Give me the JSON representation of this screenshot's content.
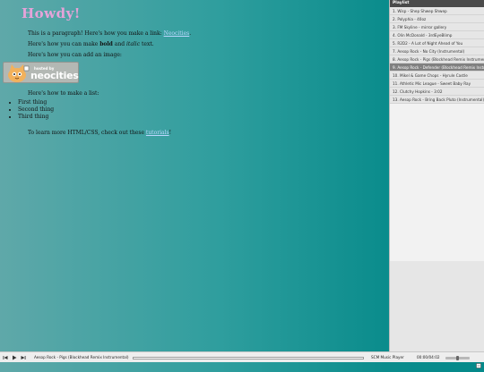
{
  "page": {
    "title": "Howdy!",
    "p1_before": "This is a paragraph! Here's how you make a link: ",
    "p1_link": "Neocities",
    "p1_after": ".",
    "p2_before": "Here's how you can make ",
    "p2_bold": "bold",
    "p2_mid": " and ",
    "p2_italic": "italic",
    "p2_after": " text.",
    "p3": "Here's how you can add an image:",
    "badge_hosted": "hosted by",
    "badge_brand": "neocities",
    "p4": "Here's how to make a list:",
    "list": [
      "First thing",
      "Second thing",
      "Third thing"
    ],
    "p5_before": "To learn more HTML/CSS, check out these ",
    "p5_link": "tutorials",
    "p5_after": "!"
  },
  "playlist": {
    "header": "Playlist",
    "active_index": 7,
    "items": [
      "1. Wisp - Shep Shwep Shwep",
      "2. Polyphia - 40oz",
      "3. FM Skyline - mirror gallery",
      "4. Olin McDonald - 3rdEyeBlimp",
      "5. R2D2 - A Lot of Night Ahead of You",
      "7. Aesop Rock - No City (Instrumental)",
      "8. Aesop Rock - Pigs (Blockhead Remix Instrumental)",
      "9. Aesop Rock - Defender (Blockhead Remix Instrumental)",
      "10. Mikel & Game Chops - Hyrule Castle",
      "11. Athletic Mic League - Sweet Baby Ray",
      "12. Clutchy Hopkins - 3:02",
      "13. Aesop Rock - Bring Back Pluto (Instrumental)"
    ]
  },
  "player": {
    "now_playing": "Aesop Rock - Pigs (Blockhead Remix Instrumental)",
    "brand": "SCM Music Player",
    "time": "00:00/04:02",
    "progress": 0.0,
    "volume": 0.5,
    "icons": {
      "prev": "previous-icon",
      "play": "play-icon",
      "next": "next-icon",
      "menu": "menu-icon"
    }
  },
  "colors": {
    "title": "#e6a3d9",
    "link": "#bcd7ff",
    "bg_left": "#5fa8a9",
    "bg_right": "#04898a",
    "active_item": "#808080"
  }
}
